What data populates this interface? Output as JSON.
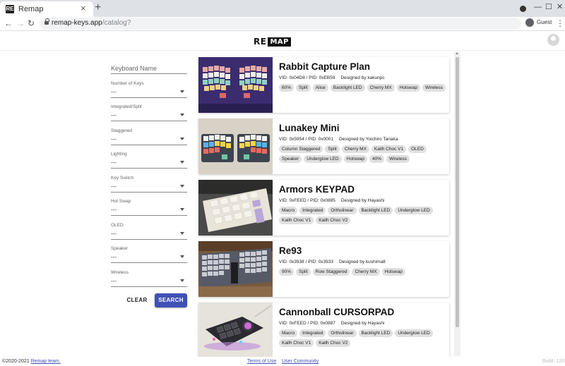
{
  "browser": {
    "tab_title": "Remap",
    "favicon_text": "RE",
    "url_host": "remap-keys.app",
    "url_path": "/catalog?",
    "profile_label": "Guest"
  },
  "app": {
    "logo_text": "RE",
    "logo_box_text": "MAP"
  },
  "filters": {
    "keyboard_name_label": "Keyboard Name",
    "items": [
      {
        "label": "Number of Keys",
        "value": "---"
      },
      {
        "label": "Integrated/Split",
        "value": "---"
      },
      {
        "label": "Staggered",
        "value": "---"
      },
      {
        "label": "Lighting",
        "value": "---"
      },
      {
        "label": "Key Switch",
        "value": "---"
      },
      {
        "label": "Hot Swap",
        "value": "---"
      },
      {
        "label": "OLED",
        "value": "---"
      },
      {
        "label": "Speaker",
        "value": "---"
      },
      {
        "label": "Wireless",
        "value": "---"
      }
    ],
    "clear_label": "CLEAR",
    "search_label": "SEARCH",
    "accent_color": "#3f51b5"
  },
  "keyboards": [
    {
      "name": "Rabbit Capture Plan",
      "ids": "VID: 0x04D8 / PID: 0xEB59",
      "designer": "Designed by kakunpc",
      "tags": [
        "60%",
        "Split",
        "Alice",
        "Backlight LED",
        "Cherry MX",
        "Hotswap",
        "Wireless"
      ]
    },
    {
      "name": "Lunakey Mini",
      "ids": "VID: 0x5954 / PID: 0x0001",
      "designer": "Designed by Yoichiro Tanaka",
      "tags": [
        "Column Staggered",
        "Split",
        "Cherry MX",
        "Kailh Choc V1",
        "OLED",
        "Speaker",
        "Underglow LED",
        "Hotswap",
        "40%",
        "Wireless"
      ]
    },
    {
      "name": "Armors KEYPAD",
      "ids": "VID: 0xFEED / PID: 0x0885",
      "designer": "Designed by Hayashi",
      "tags": [
        "Macro",
        "Integrated",
        "Ortholinear",
        "Backlight LED",
        "Underglow LED",
        "Kailh Choc V1",
        "Kailh Choc V2"
      ]
    },
    {
      "name": "Re93",
      "ids": "VID: 0x3938 / PID: 0x3933",
      "designer": "Designed by kushima8",
      "tags": [
        "90%",
        "Split",
        "Row Staggered",
        "Cherry MX",
        "Hotswap"
      ]
    },
    {
      "name": "Cannonball CURSORPAD",
      "ids": "VID: 0xFEED / PID: 0x0887",
      "designer": "Designed by Hayashi",
      "tags": [
        "Macro",
        "Integrated",
        "Ortholinear",
        "Backlight LED",
        "Underglow LED",
        "Kailh Choc V1",
        "Kailh Choc V2"
      ]
    }
  ],
  "footer": {
    "copyright": "©2020-2021",
    "team_link": "Remap team.",
    "terms": "Terms of Use",
    "community": "User Community",
    "build": "Build: 120"
  }
}
